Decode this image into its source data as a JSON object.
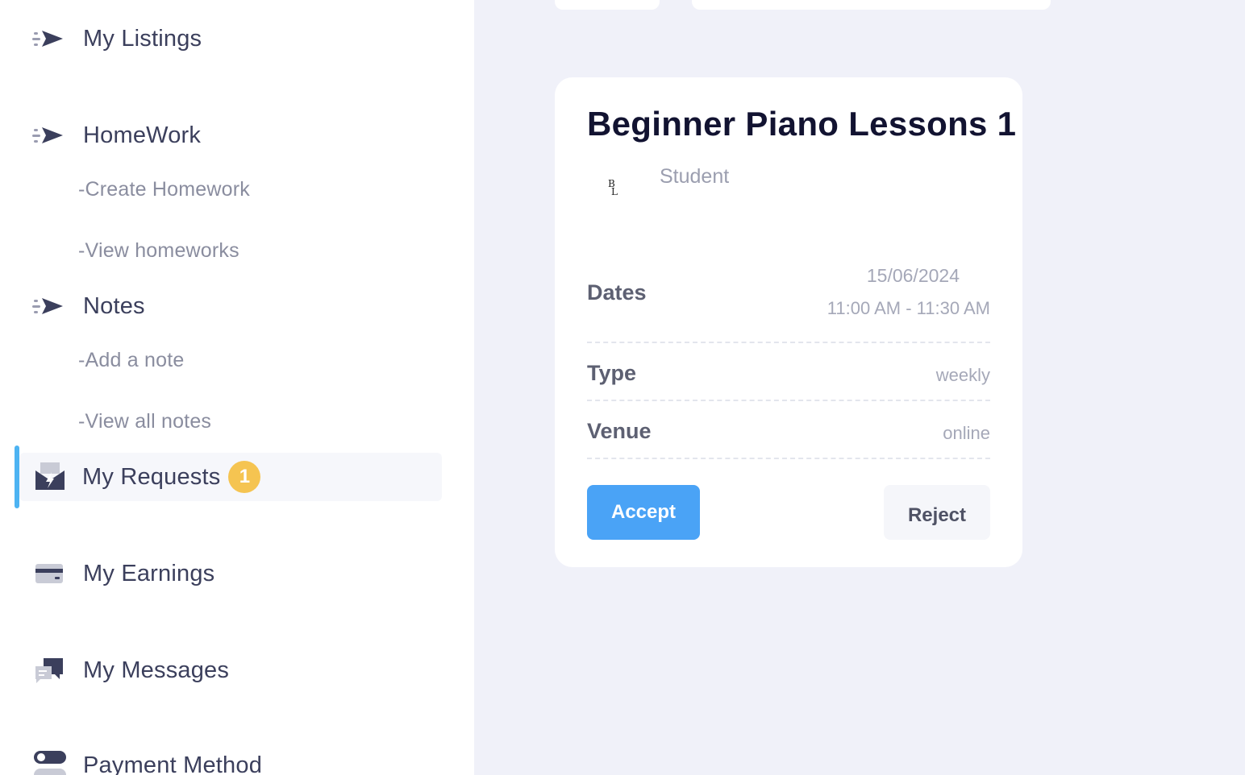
{
  "sidebar": {
    "items": [
      {
        "label": "My Listings",
        "icon": "send-icon"
      },
      {
        "label": "HomeWork",
        "icon": "send-icon",
        "subitems": [
          "-Create Homework",
          "-View homeworks"
        ]
      },
      {
        "label": "Notes",
        "icon": "send-icon",
        "subitems": [
          "-Add a note",
          "-View all notes"
        ]
      },
      {
        "label": "My Requests",
        "icon": "inbox-lightning-icon",
        "badge": "1",
        "active": true
      },
      {
        "label": "My Earnings",
        "icon": "credit-card-icon"
      },
      {
        "label": "My Messages",
        "icon": "chat-bubbles-icon"
      },
      {
        "label": "Payment Method",
        "icon": "toggle-icon"
      }
    ]
  },
  "request_card": {
    "title": "Beginner Piano Lessons 1",
    "avatar_text": "BL",
    "role": "Student",
    "dates_label": "Dates",
    "date": "15/06/2024",
    "time": "11:00 AM - 11:30 AM",
    "type_label": "Type",
    "type_value": "weekly",
    "venue_label": "Venue",
    "venue_value": "online",
    "accept_label": "Accept",
    "reject_label": "Reject"
  },
  "colors": {
    "accent": "#4aa3f6",
    "active_indicator": "#4db3f2",
    "badge": "#f5c451",
    "background": "#f0f1f9"
  }
}
